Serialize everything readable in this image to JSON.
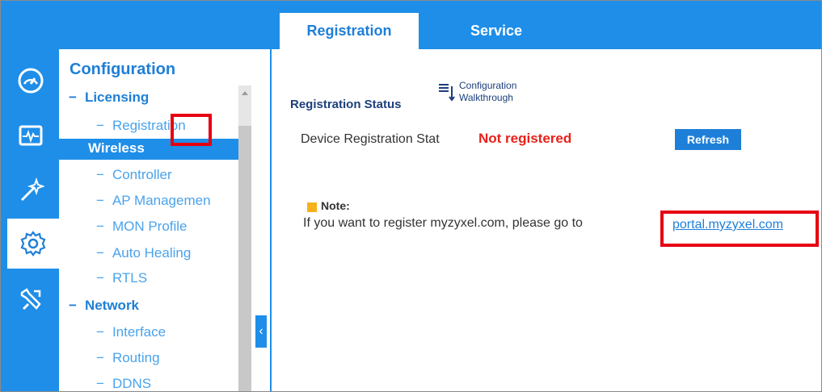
{
  "tabs": [
    {
      "label": "Registration",
      "active": true
    },
    {
      "label": "Service",
      "active": false
    }
  ],
  "rail": {
    "items": [
      {
        "icon": "dashboard-icon"
      },
      {
        "icon": "monitor-icon"
      },
      {
        "icon": "wizard-icon"
      },
      {
        "icon": "gear-icon",
        "active": true
      },
      {
        "icon": "maintenance-icon"
      }
    ]
  },
  "tree": {
    "title": "Configuration",
    "licensing": "Licensing",
    "registration": "Registration",
    "wireless": "Wireless",
    "controller": "Controller",
    "ap_management": "AP Managemen",
    "mon_profile": "MON Profile",
    "auto_healing": "Auto Healing",
    "rtls": "RTLS",
    "network": "Network",
    "interface": "Interface",
    "routing": "Routing",
    "ddns": "DDNS"
  },
  "main": {
    "registration_status": "Registration Status",
    "walkthrough_line1": "Configuration",
    "walkthrough_line2": "Walkthrough",
    "device_label": "Device Registration Stat",
    "device_value": "Not registered",
    "refresh": "Refresh",
    "note_label": "Note:",
    "note_text": "If you want to register myzyxel.com, please go to",
    "portal_link": "portal.myzyxel.com",
    "period": "."
  },
  "colors": {
    "accent": "#1e8ee8",
    "alert": "#e8201a",
    "highlight": "#e60012",
    "note": "#f5b21b"
  }
}
